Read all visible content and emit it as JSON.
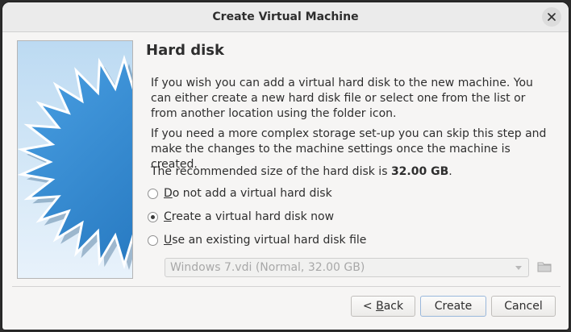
{
  "window": {
    "title": "Create Virtual Machine"
  },
  "page": {
    "heading": "Hard disk",
    "paragraph1": "If you wish you can add a virtual hard disk to the new machine. You can either create a new hard disk file or select one from the list or from another location using the folder icon.",
    "paragraph2": "If you need a more complex storage set-up you can skip this step and make the changes to the machine settings once the machine is created.",
    "recommended_prefix": "The recommended size of the hard disk is ",
    "recommended_size": "32.00 GB",
    "recommended_suffix": "."
  },
  "options": [
    {
      "label_first": "D",
      "label_rest": "o not add a virtual hard disk",
      "checked": false
    },
    {
      "label_first": "C",
      "label_rest": "reate a virtual hard disk now",
      "checked": true
    },
    {
      "label_first": "U",
      "label_rest": "se an existing virtual hard disk file",
      "checked": false
    }
  ],
  "existing_disk": {
    "selected": "Windows 7.vdi (Normal, 32.00 GB)",
    "enabled": false
  },
  "buttons": {
    "back_prefix": "< ",
    "back_mnemonic": "B",
    "back_rest": "ack",
    "create": "Create",
    "cancel": "Cancel"
  },
  "icons": {
    "close": "close-icon",
    "folder": "folder-icon"
  },
  "colors": {
    "accent_border": "#9ab8db",
    "sidebar_sky": "#bcdaf2",
    "star": "#2f86cf"
  }
}
